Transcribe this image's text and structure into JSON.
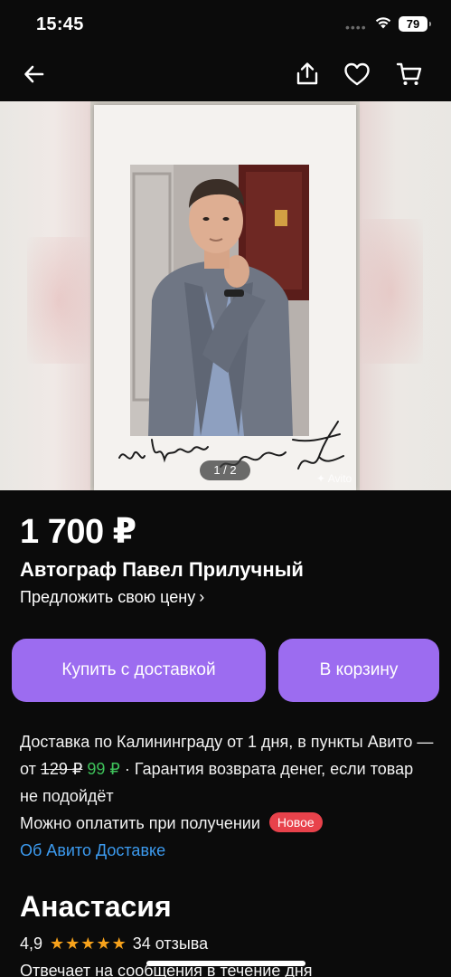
{
  "status": {
    "time": "15:45",
    "battery": "79"
  },
  "nav": {
    "back_icon": "arrow-left-icon",
    "share_icon": "share-icon",
    "favorite_icon": "heart-icon",
    "cart_icon": "cart-icon"
  },
  "gallery": {
    "counter": "1 / 2",
    "watermark": "Avito",
    "signature_text": "На память от Прилучного"
  },
  "listing": {
    "price": "1 700 ₽",
    "title": "Автограф Павел Прилучный",
    "offer_price_label": "Предложить свою цену",
    "buy_delivery_label": "Купить с доставкой",
    "add_to_cart_label": "В корзину"
  },
  "delivery": {
    "line_start": "Доставка по Калининграду от 1 дня, в пункты Авито — от ",
    "old_price": "129 ₽",
    "new_price": "99 ₽",
    "line_end": " · Гарантия возврата денег, если товар не подойдёт",
    "pay_on_receipt": "Можно оплатить при получении",
    "badge_new": "Новое",
    "about_link": "Об Авито Доставке"
  },
  "seller": {
    "name": "Анастасия",
    "rating": "4,9",
    "stars": "★★★★★",
    "reviews": "34 отзыва",
    "response": "Отвечает на сообщения в течение дня"
  },
  "colors": {
    "background": "#0b0b0b",
    "accent_button": "#9c6cf0",
    "discount_price": "#3ec25a",
    "link": "#3c9bf0",
    "badge": "#e8424b",
    "star": "#f7a21b"
  }
}
